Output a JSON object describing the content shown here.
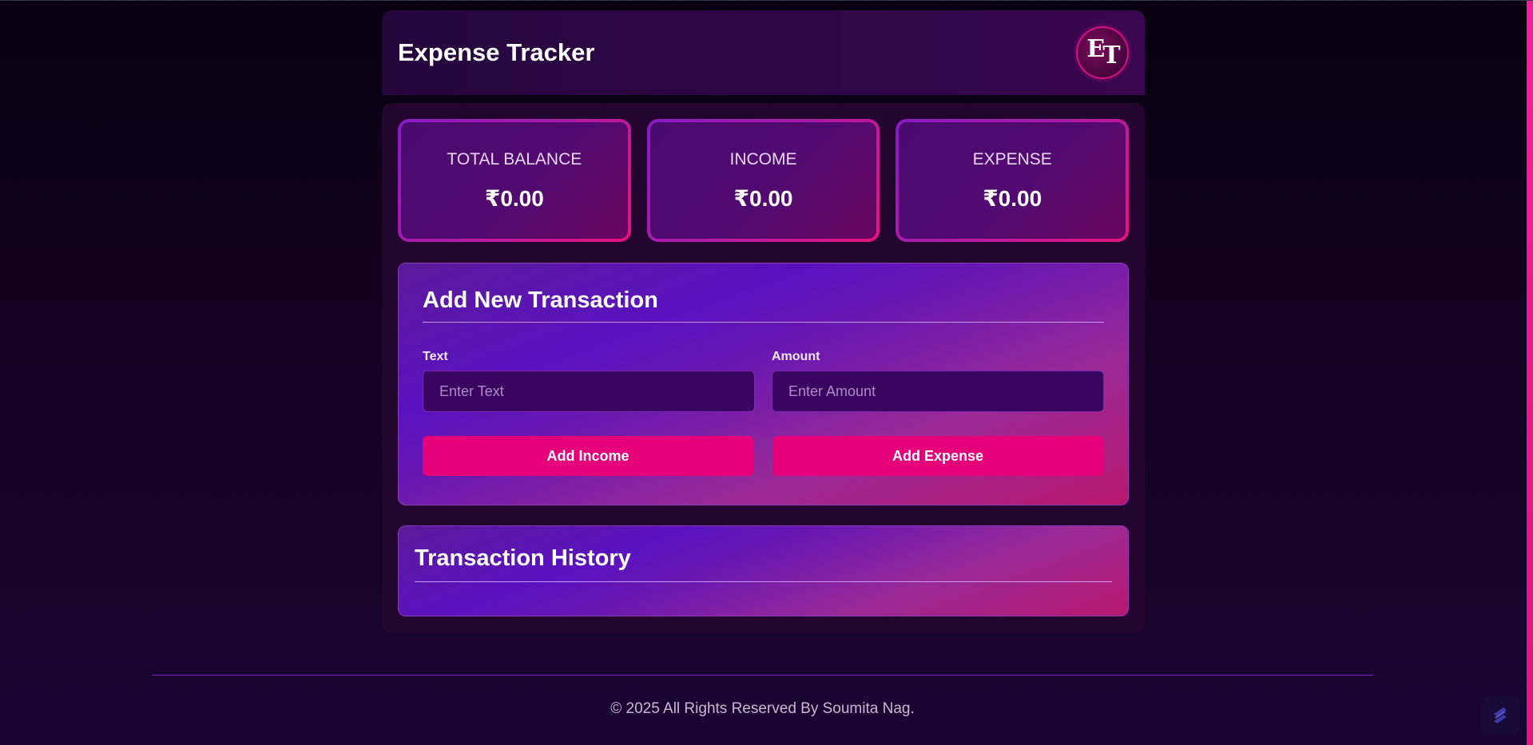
{
  "header": {
    "title": "Expense Tracker",
    "logo_text_e": "E",
    "logo_text_t": "T"
  },
  "summary": {
    "cards": [
      {
        "label": "TOTAL BALANCE",
        "value": "₹0.00"
      },
      {
        "label": "INCOME",
        "value": "₹0.00"
      },
      {
        "label": "EXPENSE",
        "value": "₹0.00"
      }
    ]
  },
  "add_transaction": {
    "title": "Add New Transaction",
    "text_label": "Text",
    "text_placeholder": "Enter Text",
    "text_value": "",
    "amount_label": "Amount",
    "amount_placeholder": "Enter Amount",
    "amount_value": "",
    "add_income_label": "Add Income",
    "add_expense_label": "Add Expense"
  },
  "history": {
    "title": "Transaction History",
    "items": []
  },
  "footer": {
    "copyright": "© 2025 All Rights Reserved By Soumita Nag."
  },
  "colors": {
    "accent_pink": "#e6007a",
    "accent_purple": "#5a12c0",
    "background": "#12021f"
  },
  "icons": {
    "corner_widget": "stack-icon"
  }
}
